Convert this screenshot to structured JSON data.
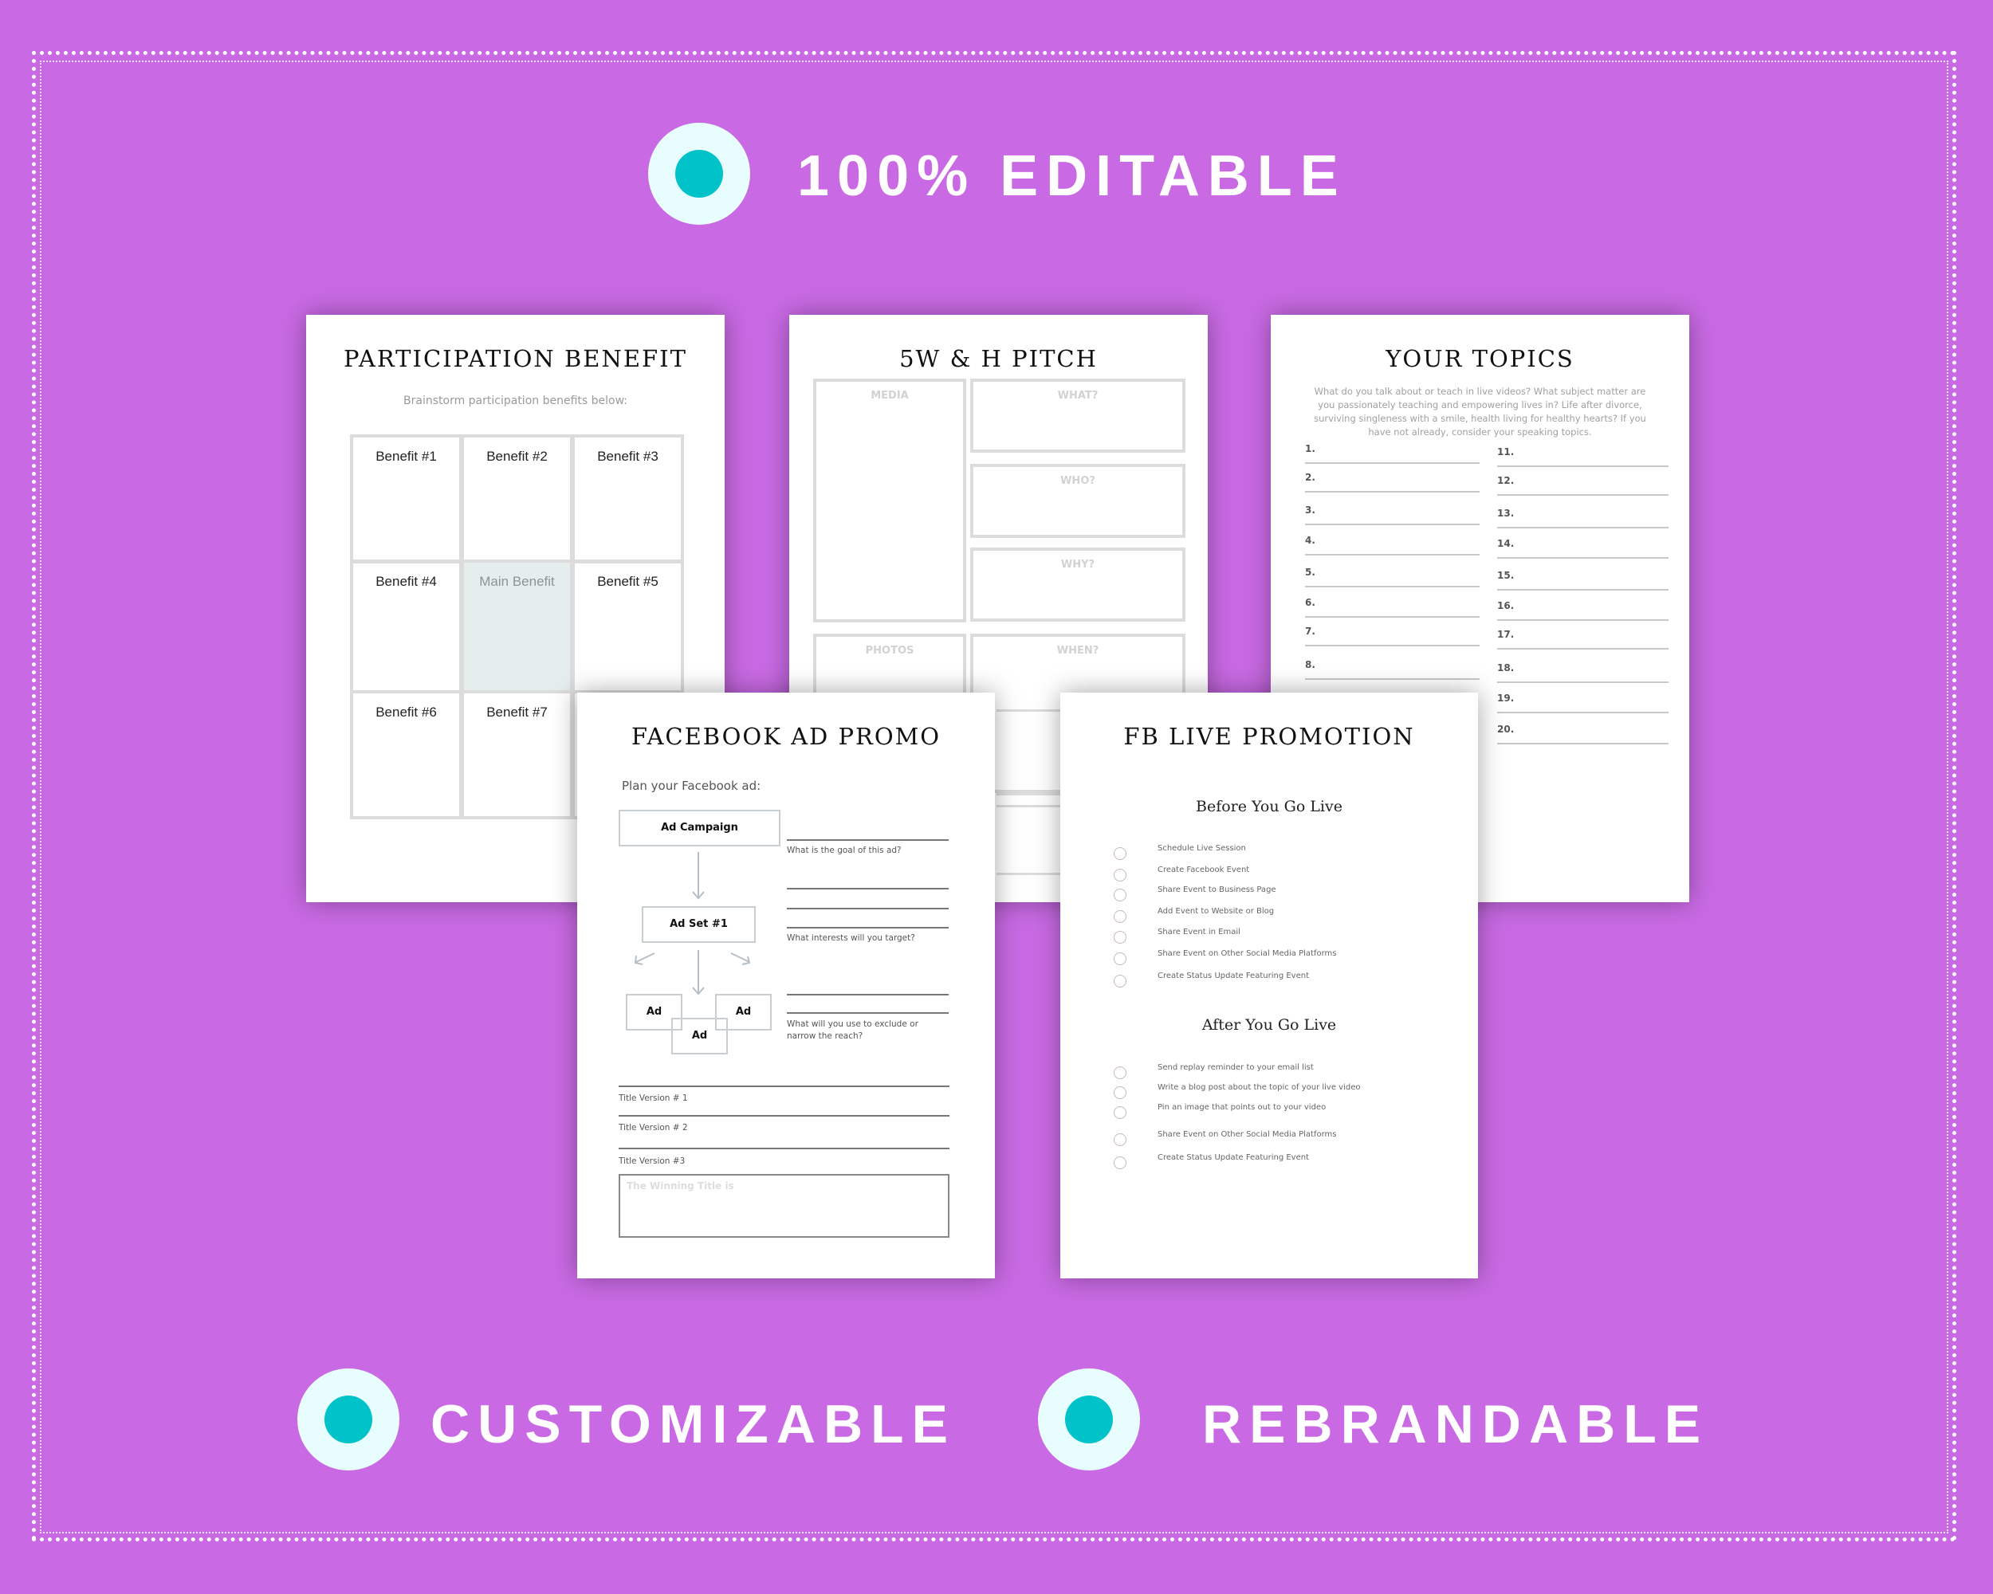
{
  "banner": {
    "top_label": "100% EDITABLE",
    "bottom_left_label": "CUSTOMIZABLE",
    "bottom_right_label": "REBRANDABLE",
    "colors": {
      "background": "#c96ae4",
      "badge_outer": "#e8fdfd",
      "badge_inner": "#00c2c9",
      "text": "#ffffff"
    }
  },
  "participation": {
    "title": "PARTICIPATION BENEFIT",
    "subtitle": "Brainstorm participation benefits below:",
    "cells": [
      "Benefit #1",
      "Benefit #2",
      "Benefit #3",
      "Benefit #4",
      "Main Benefit",
      "Benefit #5",
      "Benefit #6",
      "Benefit #7",
      ""
    ]
  },
  "pitch": {
    "title": "5W & H PITCH",
    "boxes": [
      "MEDIA",
      "WHAT?",
      "WHO?",
      "WHY?",
      "PHOTOS",
      "WHEN?"
    ]
  },
  "topics": {
    "title": "YOUR TOPICS",
    "description": "What do you talk about or teach in live videos? What subject matter are you passionately teaching and empowering lives in? Life after divorce, surviving singleness with a smile, health living for healthy hearts? If you have not already, consider your speaking topics.",
    "left_numbers": [
      "1.",
      "2.",
      "3.",
      "4.",
      "5.",
      "6.",
      "7.",
      "8."
    ],
    "right_numbers": [
      "11.",
      "12.",
      "13.",
      "14.",
      "15.",
      "16.",
      "17.",
      "18.",
      "19.",
      "20."
    ]
  },
  "fb_ad": {
    "title": "FACEBOOK AD PROMO",
    "intro": "Plan your Facebook ad:",
    "campaign": "Ad Campaign",
    "ad_set": "Ad Set #1",
    "ad_left": "Ad",
    "ad_right": "Ad",
    "ad_center": "Ad",
    "q_goal": "What is the goal of this ad?",
    "q_interests": "What interests will you target?",
    "q_exclude": "What will you use to exclude or narrow the reach?",
    "title_v1": "Title Version # 1",
    "title_v2": "Title Version # 2",
    "title_v3": "Title Version #3",
    "winning_placeholder": "The Winning Title is"
  },
  "fb_live": {
    "title": "FB LIVE PROMOTION",
    "before_heading": "Before You Go Live",
    "before_items": [
      "Schedule Live Session",
      "Create Facebook Event",
      "Share Event to Business Page",
      "Add Event to Website or Blog",
      "Share Event in Email",
      "Share Event on Other Social Media Platforms",
      "Create Status Update Featuring Event"
    ],
    "after_heading": "After You Go Live",
    "after_items": [
      "Send replay reminder  to your email list",
      "Write a blog post about the topic of your live video",
      "Pin an image that points out to your video",
      "Share Event on Other Social Media Platforms",
      "Create Status Update Featuring Event"
    ]
  }
}
